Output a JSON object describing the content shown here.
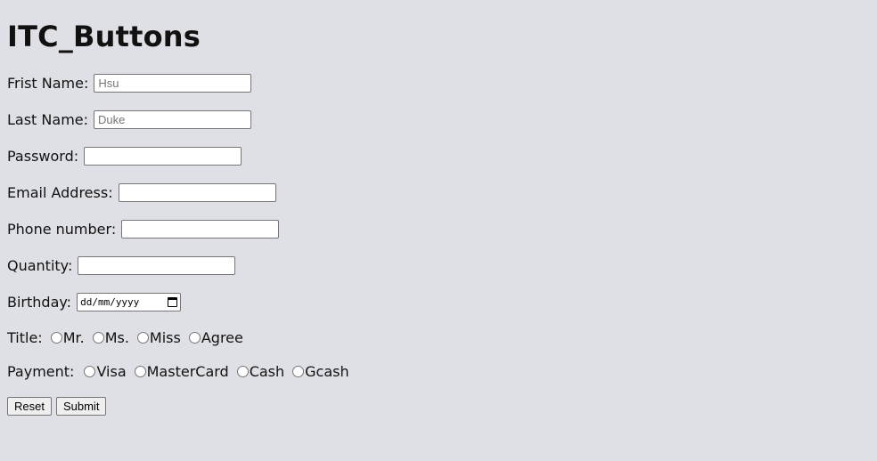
{
  "page_title": "ITC_Buttons",
  "fields": {
    "first_name": {
      "label": "Frist Name:",
      "placeholder": "Hsu"
    },
    "last_name": {
      "label": "Last Name:",
      "placeholder": "Duke"
    },
    "password": {
      "label": "Password:",
      "placeholder": ""
    },
    "email": {
      "label": "Email Address:",
      "placeholder": ""
    },
    "phone": {
      "label": "Phone number:",
      "placeholder": ""
    },
    "quantity": {
      "label": "Quantity:",
      "placeholder": ""
    },
    "birthday": {
      "label": "Birthday:",
      "placeholder": "dd/mm/yyyy"
    }
  },
  "title": {
    "label": "Title:",
    "options": [
      "Mr.",
      "Ms.",
      "Miss",
      "Agree"
    ]
  },
  "payment": {
    "label": "Payment:",
    "options": [
      "Visa",
      "MasterCard",
      "Cash",
      "Gcash"
    ]
  },
  "buttons": {
    "reset": "Reset",
    "submit": "Submit"
  }
}
